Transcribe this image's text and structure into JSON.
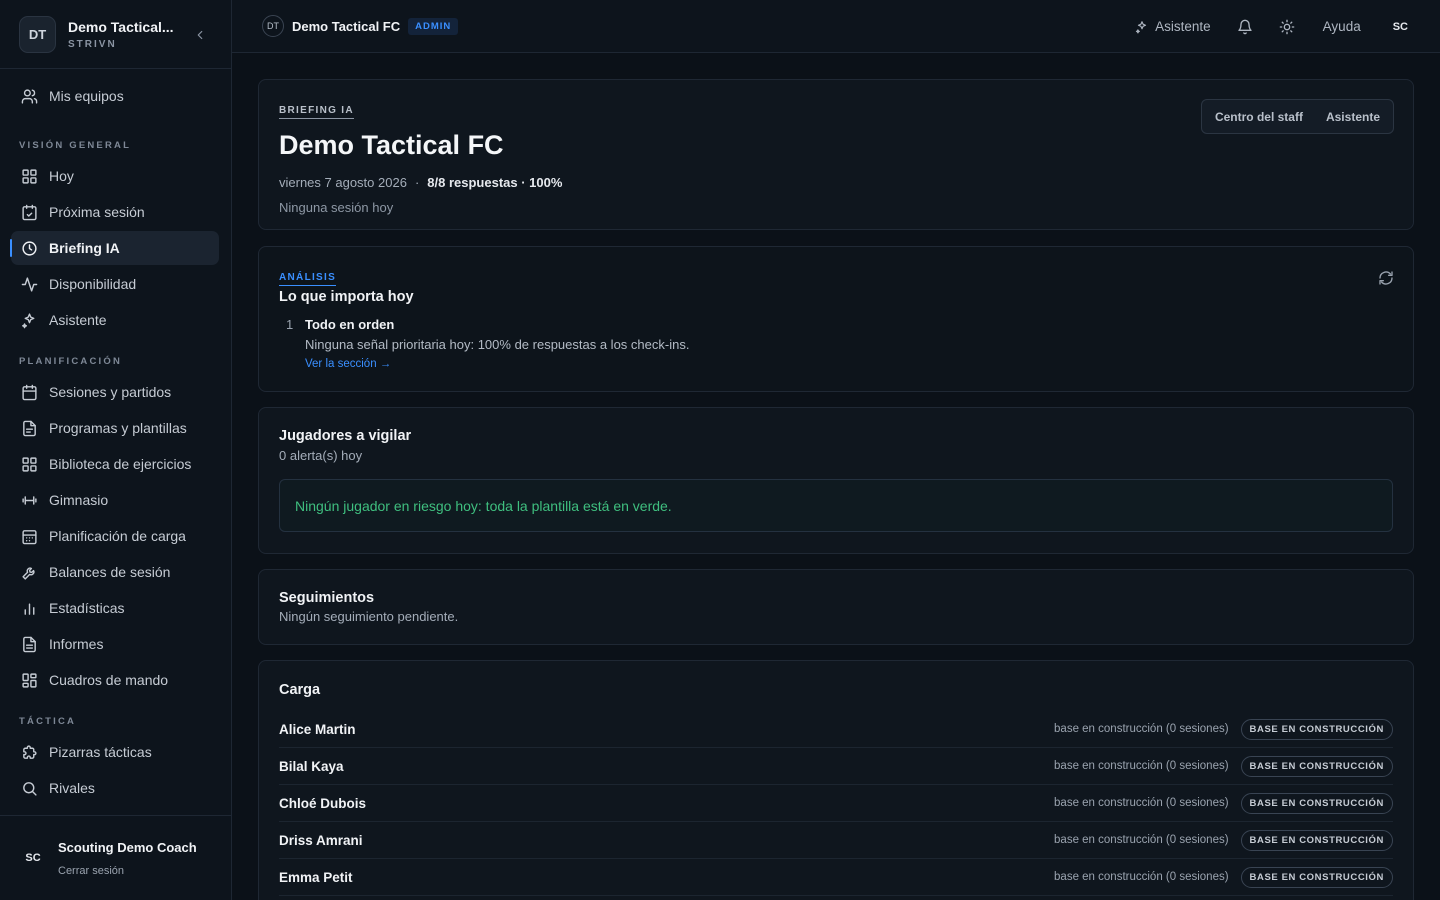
{
  "sidebar": {
    "logo_initials": "DT",
    "org_name": "Demo Tactical...",
    "org_sub": "STRIVN",
    "top_item": {
      "label": "Mis equipos",
      "icon": "users-icon"
    },
    "sections": [
      {
        "title": "VISIÓN GENERAL",
        "items": [
          {
            "label": "Hoy",
            "icon": "grid-icon"
          },
          {
            "label": "Próxima sesión",
            "icon": "calendar-check-icon"
          },
          {
            "label": "Briefing IA",
            "icon": "clock-icon",
            "active": true
          },
          {
            "label": "Disponibilidad",
            "icon": "activity-icon"
          },
          {
            "label": "Asistente",
            "icon": "sparkles-icon"
          }
        ]
      },
      {
        "title": "PLANIFICACIÓN",
        "items": [
          {
            "label": "Sesiones y partidos",
            "icon": "calendar-icon"
          },
          {
            "label": "Programas y plantillas",
            "icon": "file-icon"
          },
          {
            "label": "Biblioteca de ejercicios",
            "icon": "grid-icon"
          },
          {
            "label": "Gimnasio",
            "icon": "dumbbell-icon"
          },
          {
            "label": "Planificación de carga",
            "icon": "calendar-grid-icon"
          },
          {
            "label": "Balances de sesión",
            "icon": "wrench-icon"
          },
          {
            "label": "Estadísticas",
            "icon": "bar-chart-icon"
          },
          {
            "label": "Informes",
            "icon": "file-text-icon"
          },
          {
            "label": "Cuadros de mando",
            "icon": "dashboard-icon"
          }
        ]
      },
      {
        "title": "TÁCTICA",
        "items": [
          {
            "label": "Pizarras tácticas",
            "icon": "puzzle-icon"
          },
          {
            "label": "Rivales",
            "icon": "search-icon"
          }
        ]
      }
    ],
    "user": {
      "initials": "SC",
      "name": "Scouting Demo Coach",
      "logout": "Cerrar sesión"
    }
  },
  "topbar": {
    "logo_initials": "DT",
    "team_name": "Demo Tactical FC",
    "badge": "ADMIN",
    "assistant": "Asistente",
    "help": "Ayuda",
    "avatar": "SC"
  },
  "briefing": {
    "eyebrow": "BRIEFING IA",
    "title": "Demo Tactical FC",
    "date": "viernes 7 agosto 2026",
    "separator": "·",
    "responses": "8/8 respuestas · 100%",
    "no_session": "Ninguna sesión hoy",
    "actions": [
      "Centro del staff",
      "Asistente"
    ]
  },
  "analysis": {
    "eyebrow": "ANÁLISIS",
    "title": "Lo que importa hoy",
    "items": [
      {
        "num": "1",
        "heading": "Todo en orden",
        "desc": "Ninguna señal prioritaria hoy: 100% de respuestas a los check-ins.",
        "link": "Ver la sección →"
      }
    ]
  },
  "watch": {
    "title": "Jugadores a vigilar",
    "sub": "0 alerta(s) hoy",
    "ok": "Ningún jugador en riesgo hoy: toda la plantilla está en verde."
  },
  "followups": {
    "title": "Seguimientos",
    "sub": "Ningún seguimiento pendiente."
  },
  "load": {
    "title": "Carga",
    "rows": [
      {
        "name": "Alice Martin",
        "text": "base en construcción (0 sesiones)",
        "pill": "BASE EN CONSTRUCCIÓN"
      },
      {
        "name": "Bilal Kaya",
        "text": "base en construcción (0 sesiones)",
        "pill": "BASE EN CONSTRUCCIÓN"
      },
      {
        "name": "Chloé Dubois",
        "text": "base en construcción (0 sesiones)",
        "pill": "BASE EN CONSTRUCCIÓN"
      },
      {
        "name": "Driss Amrani",
        "text": "base en construcción (0 sesiones)",
        "pill": "BASE EN CONSTRUCCIÓN"
      },
      {
        "name": "Emma Petit",
        "text": "base en construcción (0 sesiones)",
        "pill": "BASE EN CONSTRUCCIÓN"
      }
    ]
  },
  "colors": {
    "accent": "#3a8fff",
    "ok": "#3fbf7f",
    "background": "#0b1118"
  }
}
